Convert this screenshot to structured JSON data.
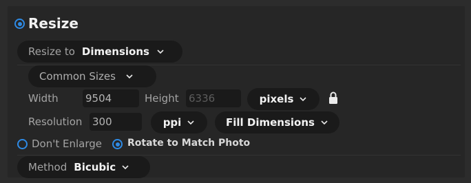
{
  "panel": {
    "title": "Resize",
    "enabled": true,
    "accent_color": "#2e8be6"
  },
  "resize_to": {
    "label": "Resize to",
    "value": "Dimensions"
  },
  "common_sizes": {
    "label": "Common Sizes"
  },
  "dimensions": {
    "width_label": "Width",
    "width_value": "9504",
    "height_label": "Height",
    "height_value": "6336",
    "unit": "pixels",
    "lock_icon": "lock-icon"
  },
  "resolution": {
    "label": "Resolution",
    "value": "300",
    "unit": "ppi",
    "fill_mode": "Fill Dimensions"
  },
  "options": {
    "dont_enlarge_label": "Don't Enlarge",
    "dont_enlarge_checked": false,
    "rotate_label": "Rotate to Match Photo",
    "rotate_checked": true
  },
  "method": {
    "label": "Method",
    "value": "Bicubic"
  }
}
